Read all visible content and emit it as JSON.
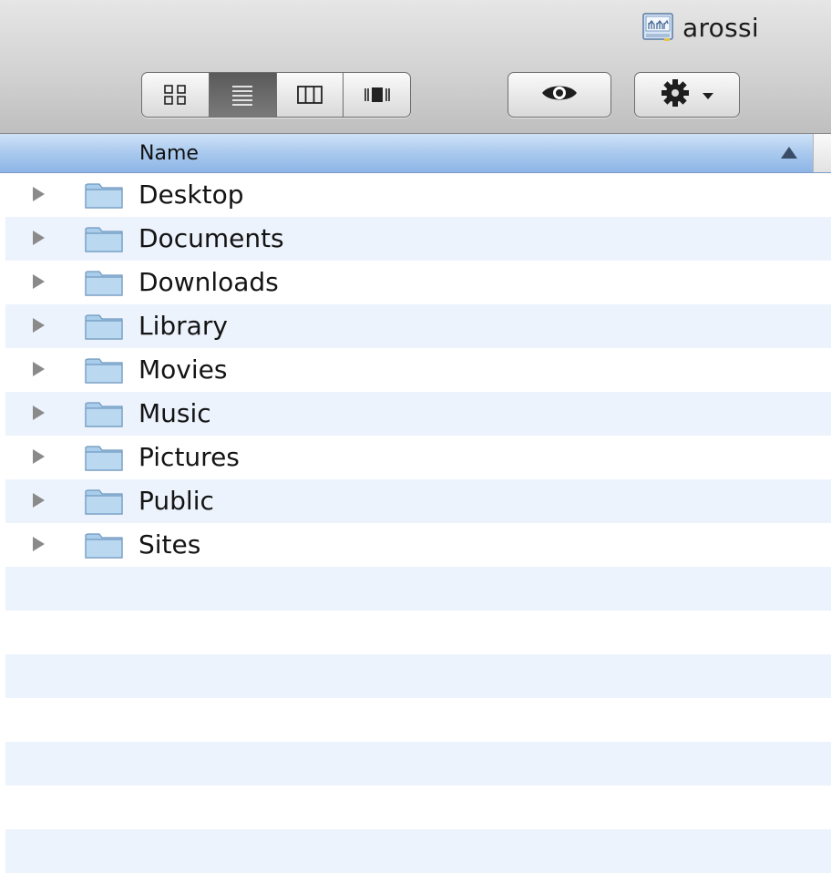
{
  "window": {
    "title": "arossi",
    "title_icon": "home-drive-icon"
  },
  "toolbar": {
    "view_modes": [
      {
        "name": "icon-view",
        "icon": "grid-icon",
        "active": false
      },
      {
        "name": "list-view",
        "icon": "list-icon",
        "active": true
      },
      {
        "name": "column-view",
        "icon": "columns-icon",
        "active": false
      },
      {
        "name": "coverflow-view",
        "icon": "coverflow-icon",
        "active": false
      }
    ],
    "quicklook_icon": "eye-icon",
    "action_icon": "gear-icon"
  },
  "header": {
    "name_column": "Name",
    "sort": "ascending"
  },
  "files": [
    {
      "name": "Desktop",
      "kind": "folder"
    },
    {
      "name": "Documents",
      "kind": "folder"
    },
    {
      "name": "Downloads",
      "kind": "folder"
    },
    {
      "name": "Library",
      "kind": "folder"
    },
    {
      "name": "Movies",
      "kind": "folder"
    },
    {
      "name": "Music",
      "kind": "folder"
    },
    {
      "name": "Pictures",
      "kind": "folder"
    },
    {
      "name": "Public",
      "kind": "folder"
    },
    {
      "name": "Sites",
      "kind": "folder"
    }
  ],
  "colors": {
    "accent": "#8db5e6",
    "stripe": "#edf3fd",
    "folder": "#9cc3e2"
  }
}
